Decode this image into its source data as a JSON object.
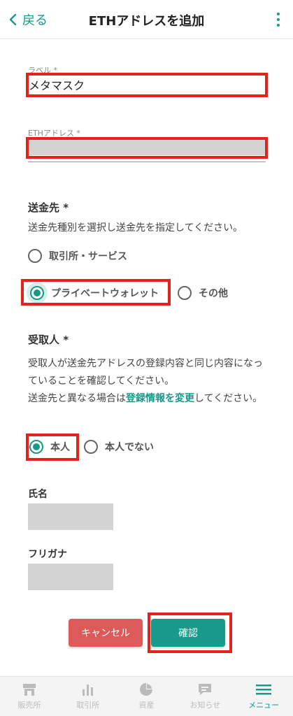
{
  "header": {
    "back_label": "戻る",
    "title": "ETHアドレスを追加"
  },
  "form": {
    "label_field": {
      "label": "ラベル *",
      "value": "メタマスク"
    },
    "address_field": {
      "label": "ETHアドレス *"
    },
    "destination": {
      "title": "送金先 *",
      "description": "送金先種別を選択し送金先を指定してください。",
      "options": [
        "取引所・サービス",
        "プライベートウォレット",
        "その他"
      ],
      "selected": "プライベートウォレット"
    },
    "recipient": {
      "title": "受取人 *",
      "description_1": "受取人が送金先アドレスの登録内容と同じ内容になっていることを確認してください。",
      "description_2_pre": "送金先と異なる場合は",
      "description_2_link": "登録情報を変更",
      "description_2_post": "してください。",
      "options": [
        "本人",
        "本人でない"
      ],
      "selected": "本人"
    },
    "name_label": "氏名",
    "furigana_label": "フリガナ"
  },
  "buttons": {
    "cancel": "キャンセル",
    "confirm": "確認"
  },
  "nav": {
    "items": [
      "販売所",
      "取引所",
      "資産",
      "お知らせ",
      "メニュー"
    ],
    "active": "メニュー"
  },
  "colors": {
    "accent": "#17998a",
    "highlight": "#e1231b",
    "cancel": "#dc5a5a"
  }
}
